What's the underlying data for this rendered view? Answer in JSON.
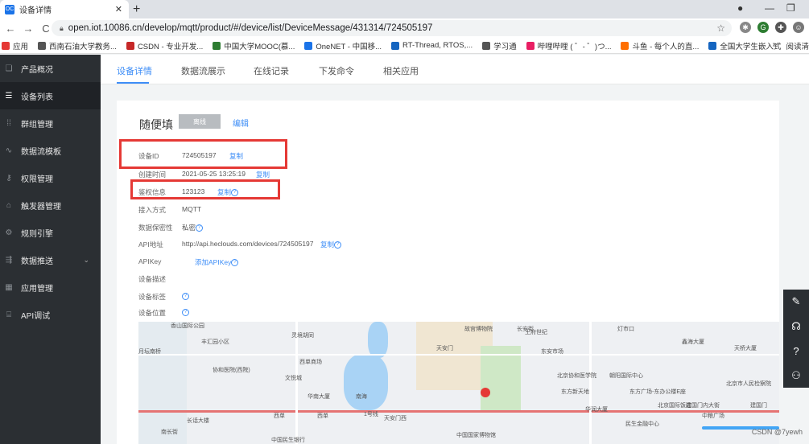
{
  "browser": {
    "tab_title": "设备详情",
    "tab_favicon": "OC",
    "url": "open.iot.10086.cn/develop/mqtt/product/#/device/list/DeviceMessage/431314/724505197",
    "bookmarks": [
      {
        "label": "应用",
        "color": "#e53935"
      },
      {
        "label": "西南石油大学教务...",
        "color": "#555555"
      },
      {
        "label": "CSDN - 专业开发...",
        "color": "#c62828"
      },
      {
        "label": "中国大学MOOC(慕...",
        "color": "#2e7d32"
      },
      {
        "label": "OneNET - 中国移...",
        "color": "#1a73e8"
      },
      {
        "label": "RT-Thread, RTOS,...",
        "color": "#1565c0"
      },
      {
        "label": "学习通",
        "color": "#555555"
      },
      {
        "label": "哔哩哔哩 ( ゜- ゜)つ...",
        "color": "#e91e63"
      },
      {
        "label": "斗鱼 - 每个人的直...",
        "color": "#ff6f00"
      },
      {
        "label": "全国大学生嵌入式...",
        "color": "#1565c0"
      }
    ],
    "bookmarks_more": "»",
    "reading_list": "阅读清"
  },
  "sidebar": {
    "items": [
      {
        "label": "产品概况",
        "icon": "cube-icon",
        "glyph": "❏",
        "active": false
      },
      {
        "label": "设备列表",
        "icon": "list-icon",
        "glyph": "☰",
        "active": true
      },
      {
        "label": "群组管理",
        "icon": "grid-icon",
        "glyph": "⁞⁞",
        "active": false
      },
      {
        "label": "数据流模板",
        "icon": "chart-icon",
        "glyph": "∿",
        "active": false
      },
      {
        "label": "权限管理",
        "icon": "key-icon",
        "glyph": "⚷",
        "active": false
      },
      {
        "label": "触发器管理",
        "icon": "bell-icon",
        "glyph": "⌂",
        "active": false
      },
      {
        "label": "规则引擎",
        "icon": "gear-icon",
        "glyph": "⚙",
        "active": false
      },
      {
        "label": "数据推送",
        "icon": "push-icon",
        "glyph": "⇶",
        "active": false,
        "expandable": true
      },
      {
        "label": "应用管理",
        "icon": "apps-icon",
        "glyph": "▦",
        "active": false
      },
      {
        "label": "API调试",
        "icon": "api-icon",
        "glyph": "⌸",
        "active": false
      }
    ]
  },
  "content_tabs": [
    "设备详情",
    "数据流展示",
    "在线记录",
    "下发命令",
    "相关应用"
  ],
  "device": {
    "name": "随便填",
    "status": "离线",
    "edit_label": "编辑",
    "fields": {
      "id_label": "设备ID",
      "id_value": "724505197",
      "id_copy": "复制",
      "created_label": "创建时间",
      "created_value": "2021-05-25 13:25:19",
      "created_copy": "复制",
      "auth_label": "鉴权信息",
      "auth_value": "123123",
      "auth_copy": "复制",
      "access_label": "接入方式",
      "access_value": "MQTT",
      "privacy_label": "数据保密性",
      "privacy_value": "私密",
      "api_label": "API地址",
      "api_value": "http://api.heclouds.com/devices/724505197",
      "api_copy": "复制",
      "apikey_label": "APIKey",
      "apikey_add": "添加APIKey",
      "desc_label": "设备描述",
      "tags_label": "设备标签",
      "location_label": "设备位置"
    }
  },
  "map_labels": [
    "香山国际公园",
    "丰汇园小区",
    "月坛南桥",
    "协和医院(西院)",
    "西单商场",
    "灵境胡同",
    "文悦城",
    "华南大厦",
    "西单",
    "西单",
    "南海",
    "天安门西",
    "天安门",
    "故宫博物院",
    "王府世纪",
    "灯市口",
    "东安市场",
    "北京协和医学院",
    "朝阳国际中心",
    "北京市人民检察院",
    "东方新天地",
    "东方广场-东办公楼E座",
    "北京国际饭店",
    "建国门内大街",
    "建国门",
    "中粮广场",
    "民生金融中心",
    "中国国家博物馆",
    "中国民生银行",
    "天桥大厦",
    "鑫海大厦",
    "华润大厦",
    "长话大楼",
    "南长街",
    "长安街",
    "1号线"
  ],
  "float_tools": [
    {
      "icon": "pencil-icon",
      "glyph": "✎"
    },
    {
      "icon": "headset-icon",
      "glyph": "☊"
    },
    {
      "icon": "help-icon",
      "glyph": "?"
    },
    {
      "icon": "users-icon",
      "glyph": "⚇"
    }
  ],
  "watermark": "CSDN @7yewh",
  "colors": {
    "accent": "#3e8ef7",
    "sidebar_bg": "#2b2f33",
    "highlight_box": "#e53935",
    "status_offline": "#b8bcc0"
  }
}
